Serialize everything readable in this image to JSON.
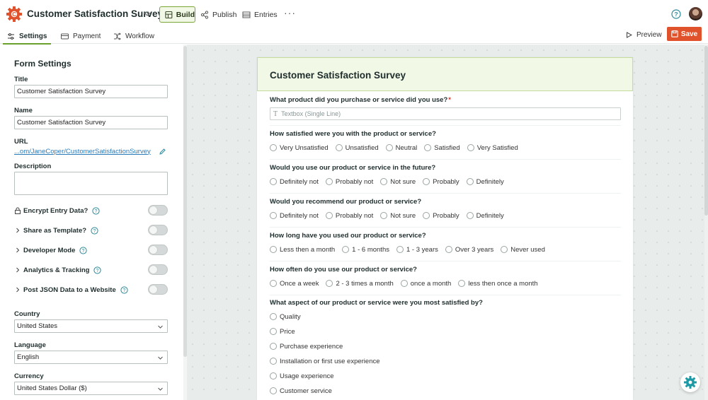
{
  "app": {
    "title": "Customer Satisfaction Survey"
  },
  "nav": {
    "build": "Build",
    "publish": "Publish",
    "entries": "Entries",
    "more": "···"
  },
  "tabs": {
    "settings": "Settings",
    "payment": "Payment",
    "workflow": "Workflow"
  },
  "actions": {
    "preview": "Preview",
    "save": "Save"
  },
  "colors": {
    "accent_green": "#6aa02c",
    "save_orange": "#e0522b",
    "link_blue": "#2a7ab8",
    "required_red": "#d2342a",
    "header_green_bg": "#f2f8e6"
  },
  "settings_panel": {
    "heading": "Form Settings",
    "title_label": "Title",
    "title_value": "Customer Satisfaction Survey",
    "name_label": "Name",
    "name_value": "Customer Satisfaction Survey",
    "url_label": "URL",
    "url_value": "...om/JaneCoper/CustomerSatisfactionSurvey",
    "description_label": "Description",
    "toggles": [
      {
        "label": "Encrypt Entry Data?",
        "icon": "lock-icon",
        "on": false
      },
      {
        "label": "Share as Template?",
        "icon": "chevron-right-icon",
        "on": false
      },
      {
        "label": "Developer Mode",
        "icon": "chevron-right-icon",
        "on": false
      },
      {
        "label": "Analytics & Tracking",
        "icon": "chevron-right-icon",
        "on": false
      },
      {
        "label": "Post JSON Data to a Website",
        "icon": "chevron-right-icon",
        "on": false
      }
    ],
    "country_label": "Country",
    "country_value": "United States",
    "language_label": "Language",
    "language_value": "English",
    "currency_label": "Currency",
    "currency_value": "United States Dollar ($)"
  },
  "form": {
    "title": "Customer Satisfaction Survey",
    "questions": [
      {
        "title": "What product did you purchase or service did you use?",
        "required": true,
        "type": "textbox",
        "placeholder": "Textbox (Single Line)"
      },
      {
        "title": "How satisfied were you with the product or service?",
        "options": [
          "Very Unsatisfied",
          "Unsatisfied",
          "Neutral",
          "Satisfied",
          "Very Satisfied"
        ]
      },
      {
        "title": "Would you use our product or service in the future?",
        "options": [
          "Definitely not",
          "Probably not",
          "Not sure",
          "Probably",
          "Definitely"
        ]
      },
      {
        "title": "Would you recommend our product or service?",
        "options": [
          "Definitely not",
          "Probably not",
          "Not sure",
          "Probably",
          "Definitely"
        ]
      },
      {
        "title": "How long have you used our product or service?",
        "options": [
          "Less then a month",
          "1 - 6 months",
          "1 - 3 years",
          "Over 3 years",
          "Never used"
        ]
      },
      {
        "title": "How often do you use our product or service?",
        "options": [
          "Once a week",
          "2 - 3 times a month",
          "once a month",
          "less then once a month"
        ]
      },
      {
        "title": "What aspect of our product or service were you most satisfied by?",
        "options": [
          "Quality",
          "Price",
          "Purchase experience",
          "Installation or first use experience",
          "Usage experience",
          "Customer service"
        ]
      }
    ]
  }
}
